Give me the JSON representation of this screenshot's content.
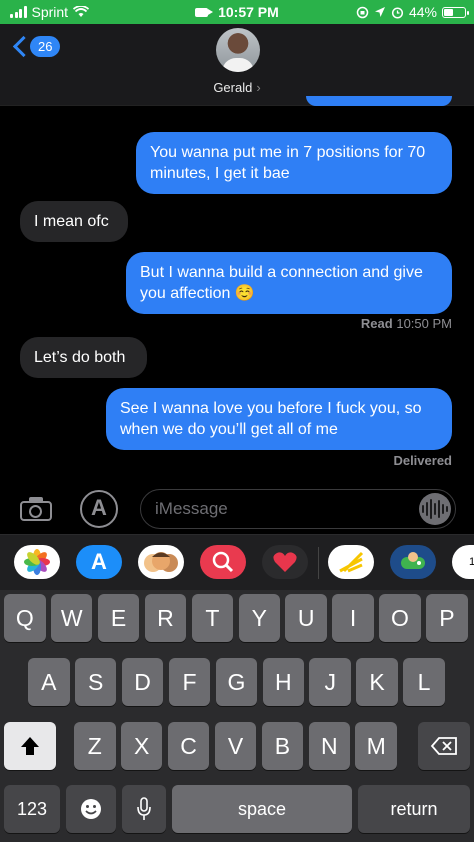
{
  "status_bar": {
    "carrier": "Sprint",
    "time": "10:57 PM",
    "battery": "44%"
  },
  "header": {
    "back_count": "26",
    "contact_name": "Gerald",
    "contact_chevron": "›"
  },
  "messages": [
    {
      "direction": "out",
      "text": "You wanna put me in 7 positions for 70 minutes, I get it bae"
    },
    {
      "direction": "in",
      "text": "I mean ofc"
    },
    {
      "direction": "out",
      "text": "But I wanna build a connection and give you affection ☺️"
    },
    {
      "direction": "meta",
      "label": "Read",
      "time": "10:50 PM"
    },
    {
      "direction": "in",
      "text": "Let’s do both"
    },
    {
      "direction": "out",
      "text": "See I wanna love you before I fuck you, so when we do you’ll get all of me"
    },
    {
      "direction": "meta",
      "label": "Delivered"
    }
  ],
  "input": {
    "placeholder": "iMessage"
  },
  "app_drawer": [
    {
      "icon": "photos-icon",
      "color": "#ffffff"
    },
    {
      "icon": "app-store-icon",
      "color": "#1c8ef9"
    },
    {
      "icon": "memoji-icon",
      "color": "#ffffff"
    },
    {
      "icon": "web-search-icon",
      "color": "#e93a4f"
    },
    {
      "icon": "digital-touch-icon",
      "color": "#2b2b2d"
    },
    {
      "icon": "sprint-icon",
      "color": "#ffffff"
    },
    {
      "icon": "game-icon",
      "color": "#1e4c8a"
    },
    {
      "icon": "calendar-icon",
      "color": "#ffffff"
    }
  ],
  "keyboard": {
    "row1": [
      "Q",
      "W",
      "E",
      "R",
      "T",
      "Y",
      "U",
      "I",
      "O",
      "P"
    ],
    "row2": [
      "A",
      "S",
      "D",
      "F",
      "G",
      "H",
      "J",
      "K",
      "L"
    ],
    "row3": [
      "Z",
      "X",
      "C",
      "V",
      "B",
      "N",
      "M"
    ],
    "numbers_label": "123",
    "space_label": "space",
    "return_label": "return"
  },
  "colors": {
    "status_bar": "#2ab24a",
    "outgoing_bubble": "#2f7ff5",
    "incoming_bubble": "#262628",
    "accent": "#2f86f6"
  }
}
